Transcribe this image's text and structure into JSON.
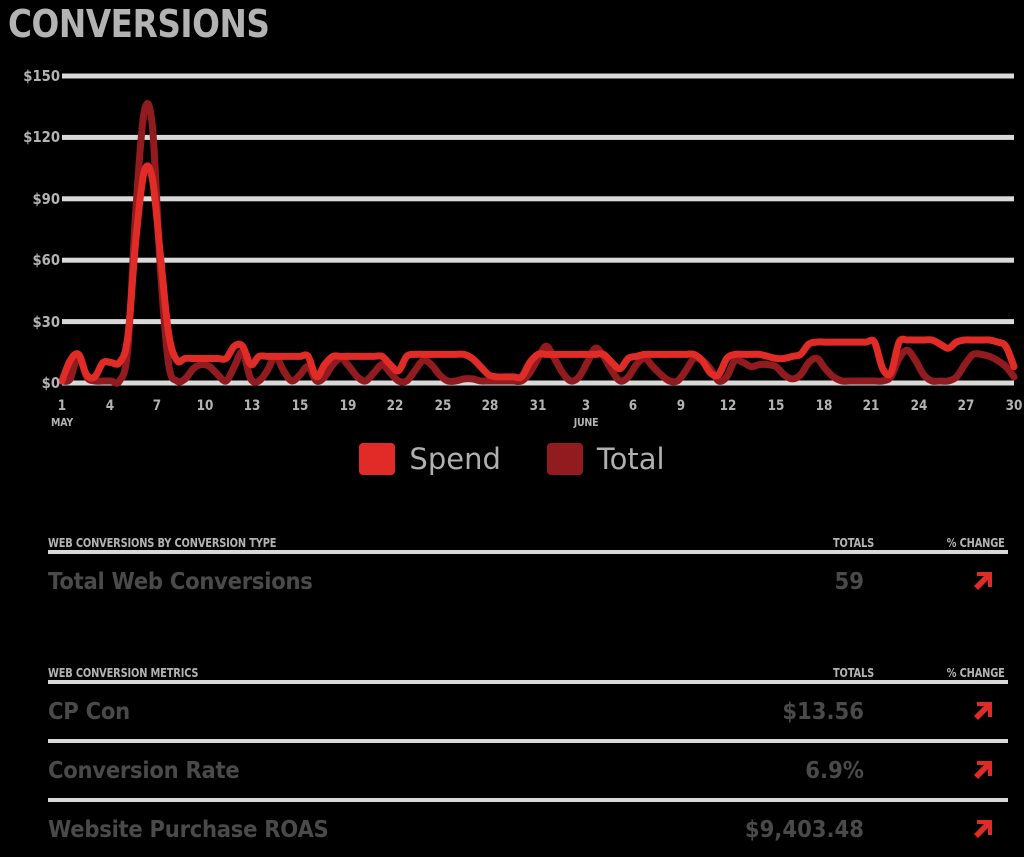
{
  "page": {
    "title": "CONVERSIONS",
    "background": "#000000",
    "title_color": "#b3b3b3"
  },
  "colors": {
    "spend": "#e02b26",
    "total": "#911b1e",
    "gridline": "#d9d9d9",
    "muted_text": "#b3b3b3",
    "value_text": "#4a4a4a",
    "arrow": "#e02b26"
  },
  "chart_data": {
    "type": "line",
    "title": "CONVERSIONS",
    "xlabel": "",
    "ylabel": "",
    "ylim": [
      0,
      150
    ],
    "yticks": [
      "$0",
      "$30",
      "$60",
      "$90",
      "$120",
      "$150"
    ],
    "ytick_values": [
      0,
      30,
      60,
      90,
      120,
      150
    ],
    "grid": true,
    "legend_position": "bottom-center",
    "x_tick_labels": [
      {
        "day": "1",
        "month": "MAY"
      },
      {
        "day": "4",
        "month": ""
      },
      {
        "day": "7",
        "month": ""
      },
      {
        "day": "10",
        "month": ""
      },
      {
        "day": "13",
        "month": ""
      },
      {
        "day": "15",
        "month": ""
      },
      {
        "day": "19",
        "month": ""
      },
      {
        "day": "22",
        "month": ""
      },
      {
        "day": "25",
        "month": ""
      },
      {
        "day": "28",
        "month": ""
      },
      {
        "day": "31",
        "month": ""
      },
      {
        "day": "3",
        "month": "JUNE"
      },
      {
        "day": "6",
        "month": ""
      },
      {
        "day": "9",
        "month": ""
      },
      {
        "day": "12",
        "month": ""
      },
      {
        "day": "15",
        "month": ""
      },
      {
        "day": "18",
        "month": ""
      },
      {
        "day": "21",
        "month": ""
      },
      {
        "day": "24",
        "month": ""
      },
      {
        "day": "27",
        "month": ""
      },
      {
        "day": "30",
        "month": ""
      }
    ],
    "series": [
      {
        "name": "Spend",
        "color": "#e02b26",
        "values": [
          1,
          11,
          14,
          4,
          3,
          10,
          10,
          10,
          22,
          70,
          103,
          100,
          62,
          24,
          11,
          12,
          12,
          12,
          12,
          12,
          12,
          18,
          18,
          9,
          13,
          13,
          13,
          13,
          13,
          13,
          13,
          3,
          9,
          13,
          13,
          13,
          13,
          13,
          13,
          13,
          9,
          6,
          13,
          14,
          14,
          14,
          14,
          14,
          14,
          14,
          12,
          8,
          4,
          3,
          3,
          3,
          3,
          10,
          14,
          14,
          14,
          14,
          14,
          14,
          14,
          14,
          14,
          10,
          7,
          12,
          13,
          14,
          14,
          14,
          14,
          14,
          14,
          14,
          11,
          5,
          4,
          12,
          14,
          14,
          14,
          14,
          13,
          12,
          12,
          13,
          14,
          19,
          20,
          20,
          20,
          20,
          20,
          20,
          20,
          20,
          7,
          5,
          20,
          21,
          21,
          21,
          21,
          19,
          17,
          20,
          21,
          21,
          21,
          21,
          20,
          18,
          8
        ]
      },
      {
        "name": "Total",
        "color": "#911b1e",
        "values": [
          1,
          2,
          14,
          3,
          1,
          1,
          1,
          1,
          16,
          85,
          132,
          126,
          55,
          9,
          1,
          2,
          7,
          9,
          8,
          4,
          1,
          8,
          15,
          2,
          1,
          6,
          13,
          6,
          1,
          4,
          8,
          1,
          3,
          9,
          12,
          8,
          3,
          1,
          5,
          9,
          5,
          1,
          1,
          6,
          11,
          9,
          4,
          1,
          1,
          2,
          2,
          1,
          1,
          1,
          1,
          1,
          1,
          5,
          12,
          18,
          12,
          5,
          1,
          3,
          10,
          17,
          13,
          6,
          1,
          3,
          9,
          12,
          8,
          4,
          1,
          1,
          6,
          12,
          11,
          7,
          1,
          3,
          11,
          10,
          8,
          9,
          9,
          8,
          4,
          2,
          4,
          10,
          12,
          7,
          3,
          1,
          1,
          1,
          1,
          1,
          1,
          3,
          12,
          16,
          11,
          4,
          1,
          1,
          1,
          3,
          9,
          14,
          14,
          13,
          11,
          8,
          3
        ]
      }
    ]
  },
  "legend": {
    "items": [
      {
        "label": "Spend",
        "color": "#e02b26"
      },
      {
        "label": "Total",
        "color": "#911b1e"
      }
    ]
  },
  "tables": [
    {
      "id": "web-conversions-by-conversion-type",
      "headers": {
        "name": "WEB CONVERSIONS BY CONVERSION TYPE",
        "totals": "TOTALS",
        "change": "% CHANGE"
      },
      "rows": [
        {
          "name": "Total Web Conversions",
          "total": "59",
          "change_direction": "up"
        }
      ]
    },
    {
      "id": "web-conversion-metrics",
      "headers": {
        "name": "WEB CONVERSION METRICS",
        "totals": "TOTALS",
        "change": "% CHANGE"
      },
      "rows": [
        {
          "name": "CP Con",
          "total": "$13.56",
          "change_direction": "up"
        },
        {
          "name": "Conversion Rate",
          "total": "6.9%",
          "change_direction": "up"
        },
        {
          "name": "Website Purchase ROAS",
          "total": "$9,403.48",
          "change_direction": "up"
        }
      ]
    }
  ]
}
